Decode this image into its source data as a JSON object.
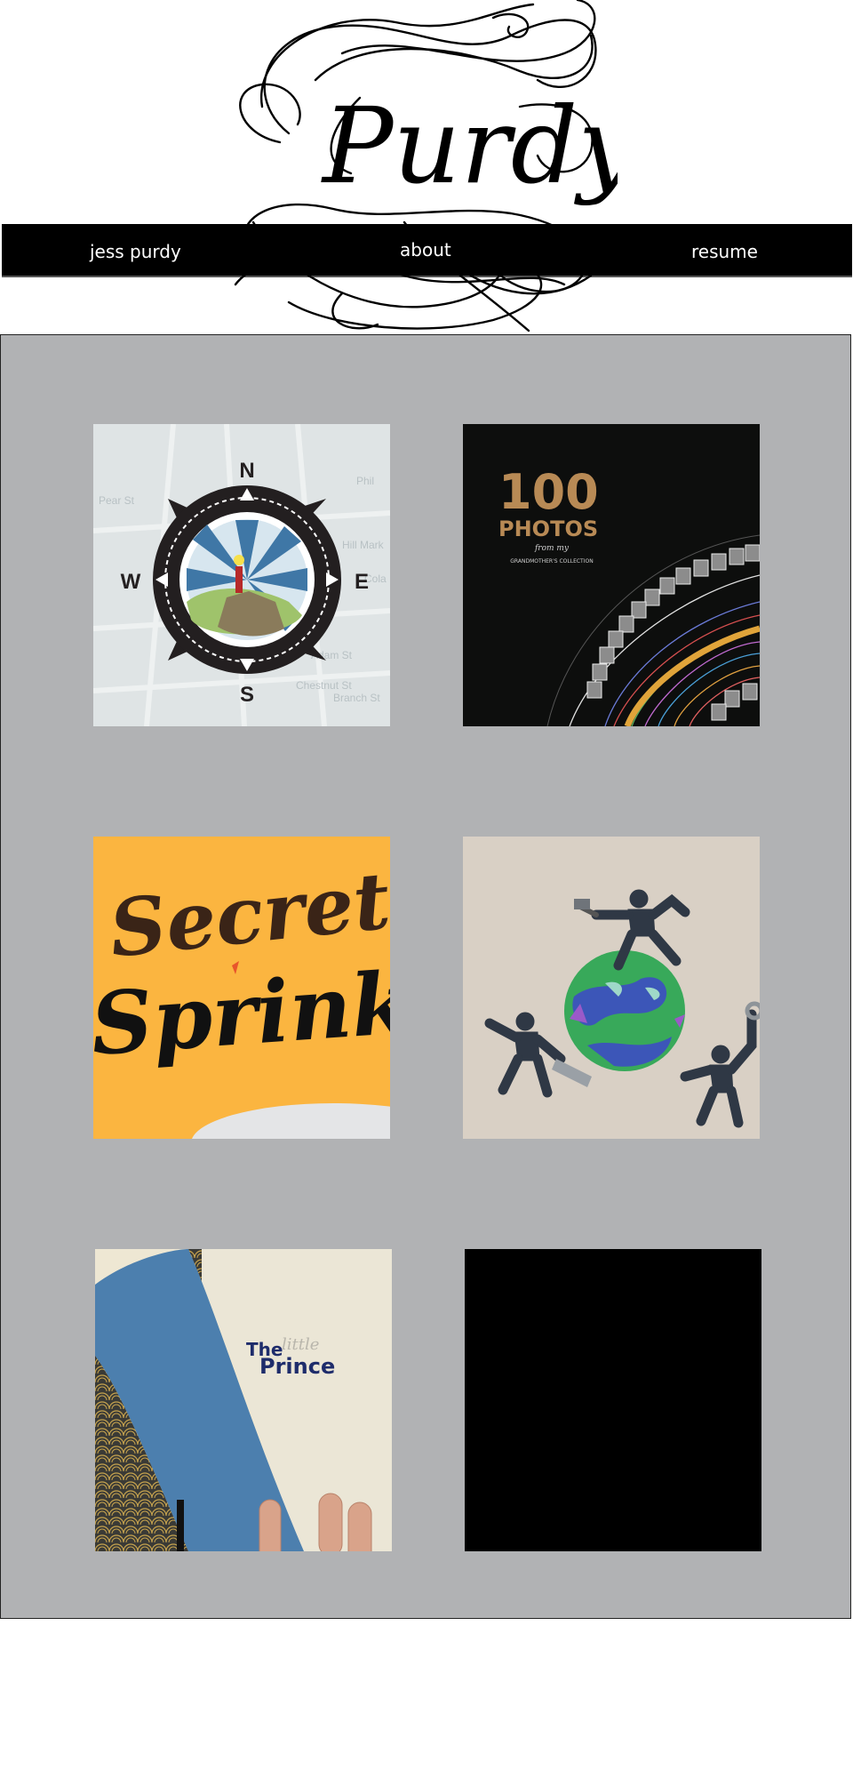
{
  "header": {
    "logo_text": "Purdy"
  },
  "nav": {
    "home_label": "jess purdy",
    "about_label": "about",
    "resume_label": "resume"
  },
  "portfolio": {
    "items": [
      {
        "name": "compass-map",
        "compass": {
          "n": "N",
          "s": "S",
          "e": "E",
          "w": "W"
        },
        "streets": [
          "Phil",
          "Adam St",
          "Chestnut St",
          "Branch St",
          "Pear St",
          "Hill Mark",
          "Cola"
        ]
      },
      {
        "name": "100-photos",
        "title_number": "100",
        "title_word": "PHOTOS",
        "subtitle_small": "from my",
        "subtitle": "GRANDMOTHER'S COLLECTION"
      },
      {
        "name": "secret-sprinkle",
        "line1": "Secret",
        "line2": "Sprinkle"
      },
      {
        "name": "clay-figures-globe"
      },
      {
        "name": "little-prince-book",
        "word_the": "The",
        "word_little": "little",
        "word_prince": "Prince"
      },
      {
        "name": "black-tile"
      }
    ]
  },
  "colors": {
    "panel_bg": "#b1b2b4",
    "nav_bg": "#000000",
    "sprinkle_bg": "#fbb540",
    "photos_bronze": "#b88a55",
    "prince_navy": "#1e2c6b"
  }
}
